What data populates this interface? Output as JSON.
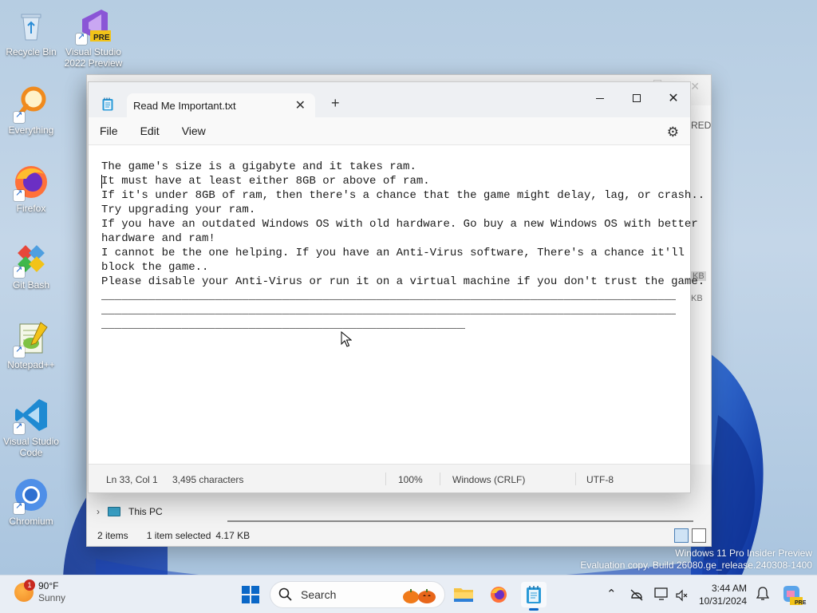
{
  "desktop": {
    "icons": [
      {
        "label_line1": "Recycle Bin",
        "label_line2": "",
        "icon": "recycle-bin-icon"
      },
      {
        "label_line1": "Visual Studio",
        "label_line2": "2022 Preview",
        "icon": "visual-studio-preview-icon",
        "badge": "PRE"
      },
      {
        "label_line1": "Everything",
        "label_line2": "",
        "icon": "everything-search-icon"
      },
      {
        "label_line1": "Firefox",
        "label_line2": "",
        "icon": "firefox-icon"
      },
      {
        "label_line1": "Git Bash",
        "label_line2": "",
        "icon": "git-bash-icon"
      },
      {
        "label_line1": "Notepad++",
        "label_line2": "",
        "icon": "notepad-plus-plus-icon"
      },
      {
        "label_line1": "Visual Studio",
        "label_line2": "Code",
        "icon": "vscode-icon"
      },
      {
        "label_line1": "Chromium",
        "label_line2": "",
        "icon": "chromium-icon"
      }
    ]
  },
  "explorer": {
    "column_fragment": "RED",
    "size_fragment_1": "KB",
    "size_fragment_2": "KB",
    "nav_this_pc": "This PC",
    "status_items": "2 items",
    "status_selected": "1 item selected",
    "status_size": "4.17 KB"
  },
  "notepad": {
    "tab_title": "Read Me Important.txt",
    "new_tab_symbol": "+",
    "menu": [
      "File",
      "Edit",
      "View"
    ],
    "lines": [
      "The game's size is a gigabyte and it takes ram.",
      "It must have at least either 8GB or above of ram.",
      "If it's under 8GB of ram, then there's a chance that the game might delay, lag, or crash..",
      "Try upgrading your ram.",
      "If you have an outdated Windows OS with old hardware. Go buy a new Windows OS with better",
      "hardware and ram!",
      "I cannot be the one helping. If you have an Anti-Virus software, There's a chance it'll",
      "block the game..",
      "Please disable your Anti-Virus or run it on a virtual machine if you don't trust the game.",
      "________________________________________________________________________________________________________",
      "________________________________________________________________________________________________________",
      "_________________________________________________________________"
    ],
    "status": {
      "position": "Ln 33, Col 1",
      "characters": "3,495 characters",
      "zoom": "100%",
      "line_endings": "Windows (CRLF)",
      "encoding": "UTF-8"
    }
  },
  "watermark": {
    "line1": "Windows 11 Pro Insider Preview",
    "line2": "Evaluation copy. Build 26080.ge_release.240308-1400"
  },
  "taskbar": {
    "weather_badge": "1",
    "temperature": "90°F",
    "condition": "Sunny",
    "search_placeholder": "Search",
    "time": "3:44 AM",
    "date": "10/31/2024",
    "copilot_badge": "PRE"
  },
  "colors": {
    "accent": "#0a67c7",
    "taskbar_bg": "#e9eef5",
    "notepad_bg": "#ffffff"
  }
}
